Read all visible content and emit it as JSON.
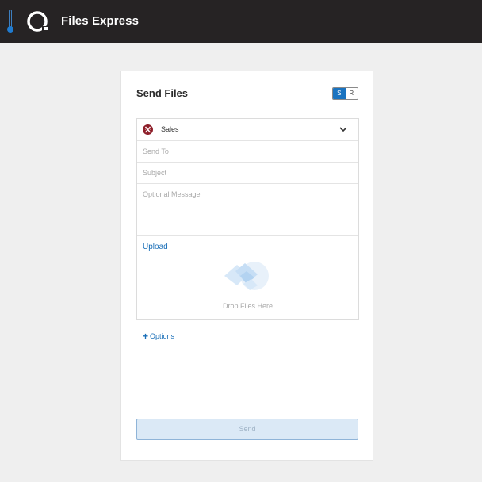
{
  "header": {
    "app_title": "Files Express",
    "logo_icon": "files-express-logo-icon",
    "status_icon": "thermometer-indicator-icon"
  },
  "send_panel": {
    "title": "Send Files",
    "mode_toggle": {
      "options": [
        "S",
        "R"
      ],
      "selected": "S"
    },
    "account": {
      "label": "Sales",
      "icon": "sales-account-icon"
    },
    "send_to_placeholder": "Send To",
    "subject_placeholder": "Subject",
    "message_placeholder": "Optional Message",
    "upload_label": "Upload",
    "drop_text": "Drop Files Here",
    "options_label": "Options",
    "send_label": "Send"
  },
  "colors": {
    "accent": "#1a73c0",
    "topbar": "#262324",
    "page_bg": "#efefef"
  }
}
